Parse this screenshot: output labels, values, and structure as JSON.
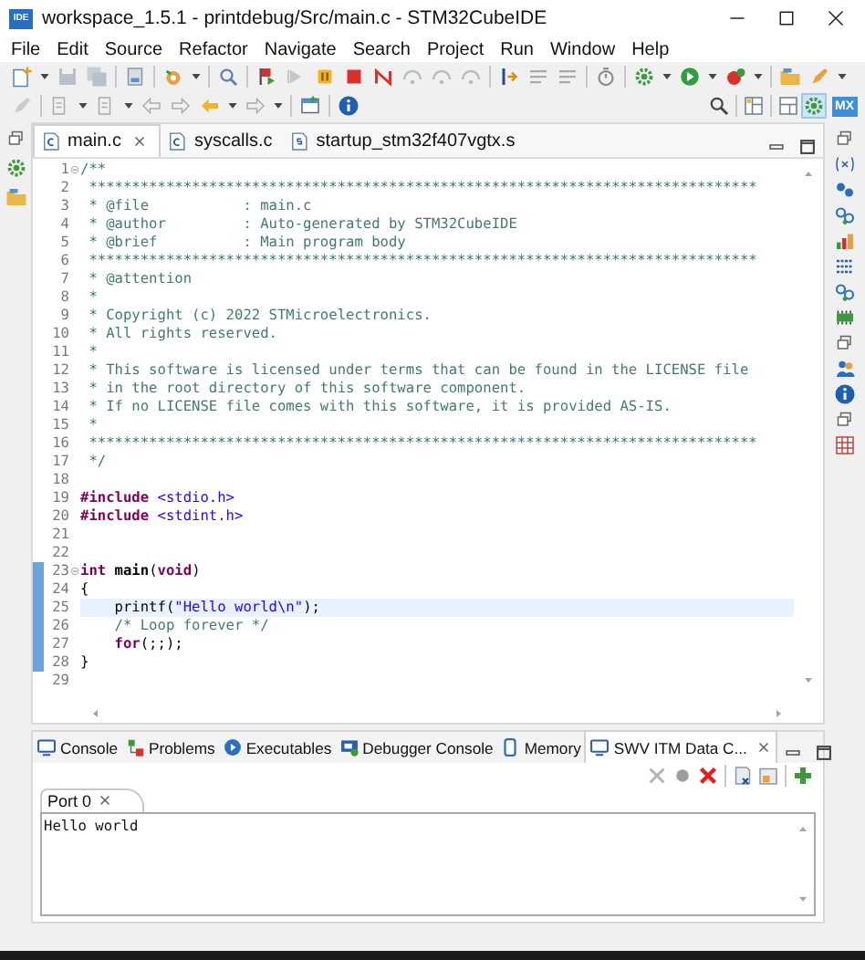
{
  "window": {
    "title": "workspace_1.5.1 - printdebug/Src/main.c - STM32CubeIDE",
    "app_icon_text": "IDE"
  },
  "menu": [
    "File",
    "Edit",
    "Source",
    "Refactor",
    "Navigate",
    "Search",
    "Project",
    "Run",
    "Window",
    "Help"
  ],
  "toolbar": {
    "perspective_badge": "MX"
  },
  "editor": {
    "tabs": [
      {
        "label": "main.c",
        "selected": true
      },
      {
        "label": "syscalls.c",
        "selected": false
      },
      {
        "label": "startup_stm32f407vgtx.s",
        "selected": false
      }
    ],
    "lines": [
      {
        "number": "1",
        "foldable": true,
        "marked": false,
        "current": false,
        "segments": [
          {
            "text": "/**",
            "kind": "comment"
          }
        ]
      },
      {
        "number": "2",
        "foldable": false,
        "marked": false,
        "current": false,
        "segments": [
          {
            "text": " ******************************************************************************",
            "kind": "comment"
          }
        ]
      },
      {
        "number": "3",
        "foldable": false,
        "marked": false,
        "current": false,
        "segments": [
          {
            "text": " * @file           : main.c",
            "kind": "comment"
          }
        ]
      },
      {
        "number": "4",
        "foldable": false,
        "marked": false,
        "current": false,
        "segments": [
          {
            "text": " * @author         : Auto-generated by STM32CubeIDE",
            "kind": "comment"
          }
        ]
      },
      {
        "number": "5",
        "foldable": false,
        "marked": false,
        "current": false,
        "segments": [
          {
            "text": " * @brief          : Main program body",
            "kind": "comment"
          }
        ]
      },
      {
        "number": "6",
        "foldable": false,
        "marked": false,
        "current": false,
        "segments": [
          {
            "text": " ******************************************************************************",
            "kind": "comment"
          }
        ]
      },
      {
        "number": "7",
        "foldable": false,
        "marked": false,
        "current": false,
        "segments": [
          {
            "text": " * @attention",
            "kind": "comment"
          }
        ]
      },
      {
        "number": "8",
        "foldable": false,
        "marked": false,
        "current": false,
        "segments": [
          {
            "text": " *",
            "kind": "comment"
          }
        ]
      },
      {
        "number": "9",
        "foldable": false,
        "marked": false,
        "current": false,
        "segments": [
          {
            "text": " * Copyright (c) 2022 STMicroelectronics.",
            "kind": "comment"
          }
        ]
      },
      {
        "number": "10",
        "foldable": false,
        "marked": false,
        "current": false,
        "segments": [
          {
            "text": " * All rights reserved.",
            "kind": "comment"
          }
        ]
      },
      {
        "number": "11",
        "foldable": false,
        "marked": false,
        "current": false,
        "segments": [
          {
            "text": " *",
            "kind": "comment"
          }
        ]
      },
      {
        "number": "12",
        "foldable": false,
        "marked": false,
        "current": false,
        "segments": [
          {
            "text": " * This software is licensed under terms that can be found in the LICENSE file",
            "kind": "comment"
          }
        ]
      },
      {
        "number": "13",
        "foldable": false,
        "marked": false,
        "current": false,
        "segments": [
          {
            "text": " * in the root directory of this software component.",
            "kind": "comment"
          }
        ]
      },
      {
        "number": "14",
        "foldable": false,
        "marked": false,
        "current": false,
        "segments": [
          {
            "text": " * If no LICENSE file comes with this software, it is provided AS-IS.",
            "kind": "comment"
          }
        ]
      },
      {
        "number": "15",
        "foldable": false,
        "marked": false,
        "current": false,
        "segments": [
          {
            "text": " *",
            "kind": "comment"
          }
        ]
      },
      {
        "number": "16",
        "foldable": false,
        "marked": false,
        "current": false,
        "segments": [
          {
            "text": " ******************************************************************************",
            "kind": "comment"
          }
        ]
      },
      {
        "number": "17",
        "foldable": false,
        "marked": false,
        "current": false,
        "segments": [
          {
            "text": " */",
            "kind": "comment"
          }
        ]
      },
      {
        "number": "18",
        "foldable": false,
        "marked": false,
        "current": false
      },
      {
        "number": "19",
        "foldable": false,
        "marked": false,
        "current": false,
        "segments": [
          {
            "text": "#include",
            "kind": "keyword"
          },
          {
            "text": " <stdio.h>",
            "kind": "string"
          }
        ]
      },
      {
        "number": "20",
        "foldable": false,
        "marked": false,
        "current": false,
        "segments": [
          {
            "text": "#include",
            "kind": "keyword"
          },
          {
            "text": " <stdint.h>",
            "kind": "string"
          }
        ]
      },
      {
        "number": "21",
        "foldable": false,
        "marked": false,
        "current": false
      },
      {
        "number": "22",
        "foldable": false,
        "marked": false,
        "current": false
      },
      {
        "number": "23",
        "foldable": true,
        "marked": true,
        "current": false,
        "segments": [
          {
            "text": "int",
            "kind": "keyword"
          },
          {
            "text": " main",
            "kind": "bold"
          },
          {
            "text": "(",
            "kind": "plain"
          },
          {
            "text": "void",
            "kind": "keyword"
          },
          {
            "text": ")",
            "kind": "plain"
          }
        ]
      },
      {
        "number": "24",
        "foldable": false,
        "marked": true,
        "current": false,
        "segments": [
          {
            "text": "{",
            "kind": "plain"
          }
        ]
      },
      {
        "number": "25",
        "foldable": false,
        "marked": true,
        "current": true,
        "segments": [
          {
            "text": "    printf(",
            "kind": "plain"
          },
          {
            "text": "\"Hello world\\n\"",
            "kind": "string"
          },
          {
            "text": ");",
            "kind": "plain"
          }
        ]
      },
      {
        "number": "26",
        "foldable": false,
        "marked": true,
        "current": false,
        "segments": [
          {
            "text": "    /* Loop forever */",
            "kind": "comment"
          }
        ]
      },
      {
        "number": "27",
        "foldable": false,
        "marked": true,
        "current": false,
        "segments": [
          {
            "text": "    for",
            "kind": "keyword"
          },
          {
            "text": "(;;);",
            "kind": "plain"
          }
        ]
      },
      {
        "number": "28",
        "foldable": false,
        "marked": true,
        "current": false,
        "segments": [
          {
            "text": "}",
            "kind": "plain"
          }
        ]
      },
      {
        "number": "29",
        "foldable": false,
        "marked": false,
        "current": false
      }
    ]
  },
  "bottom_panel": {
    "tabs": [
      {
        "label": "Console",
        "selected": false,
        "kind": "monitor"
      },
      {
        "label": "Problems",
        "selected": false,
        "kind": "problems"
      },
      {
        "label": "Executables",
        "selected": false,
        "kind": "circle"
      },
      {
        "label": "Debugger Console",
        "selected": false,
        "kind": "debugmonitor"
      },
      {
        "label": "Memory",
        "selected": false,
        "kind": "memory"
      },
      {
        "label": "SWV ITM Data C...",
        "selected": true,
        "kind": "monitor"
      }
    ],
    "port_tabs": [
      {
        "label": "Port 0",
        "selected": true
      }
    ],
    "output": "Hello world"
  }
}
